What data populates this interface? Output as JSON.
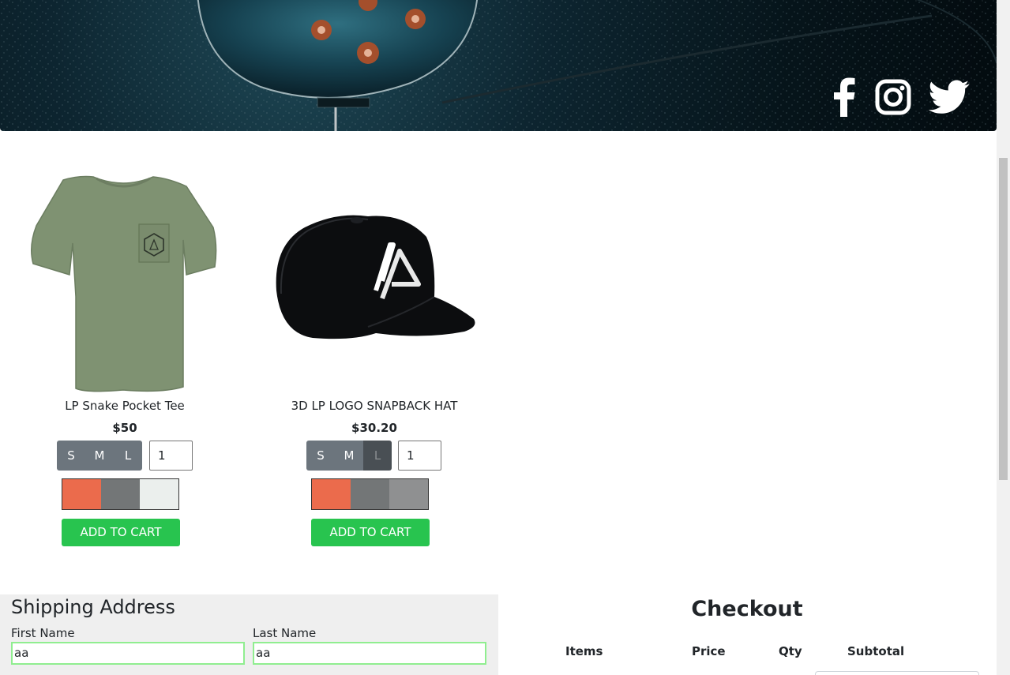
{
  "header": {
    "social": [
      {
        "name": "facebook-icon"
      },
      {
        "name": "instagram-icon"
      },
      {
        "name": "twitter-icon"
      }
    ]
  },
  "products": [
    {
      "name": "LP Snake Pocket Tee",
      "price": "$50",
      "image": "olive-pocket-tee",
      "sizes": [
        "S",
        "M",
        "L"
      ],
      "selected_size": "",
      "quantity": "1",
      "colors": [
        "#eb6b4c",
        "#737677",
        "#ebefed"
      ],
      "add_label": "ADD TO CART"
    },
    {
      "name": "3D LP LOGO SNAPBACK HAT",
      "price": "$30.20",
      "image": "black-snapback-hat",
      "sizes": [
        "S",
        "M",
        "L"
      ],
      "selected_size": "L",
      "quantity": "1",
      "colors": [
        "#eb6b4c",
        "#737677",
        "#8f9091"
      ],
      "add_label": "ADD TO CART"
    }
  ],
  "shipping": {
    "title": "Shipping Address",
    "first_name_label": "First Name",
    "first_name_value": "aa",
    "last_name_label": "Last Name",
    "last_name_value": "aa"
  },
  "checkout": {
    "title": "Checkout",
    "columns": [
      "Items",
      "Price",
      "Qty",
      "Subtotal"
    ]
  },
  "colors": {
    "accent_green": "#28c44f",
    "valid_border": "#90ee90",
    "size_button": "#6c757d"
  }
}
